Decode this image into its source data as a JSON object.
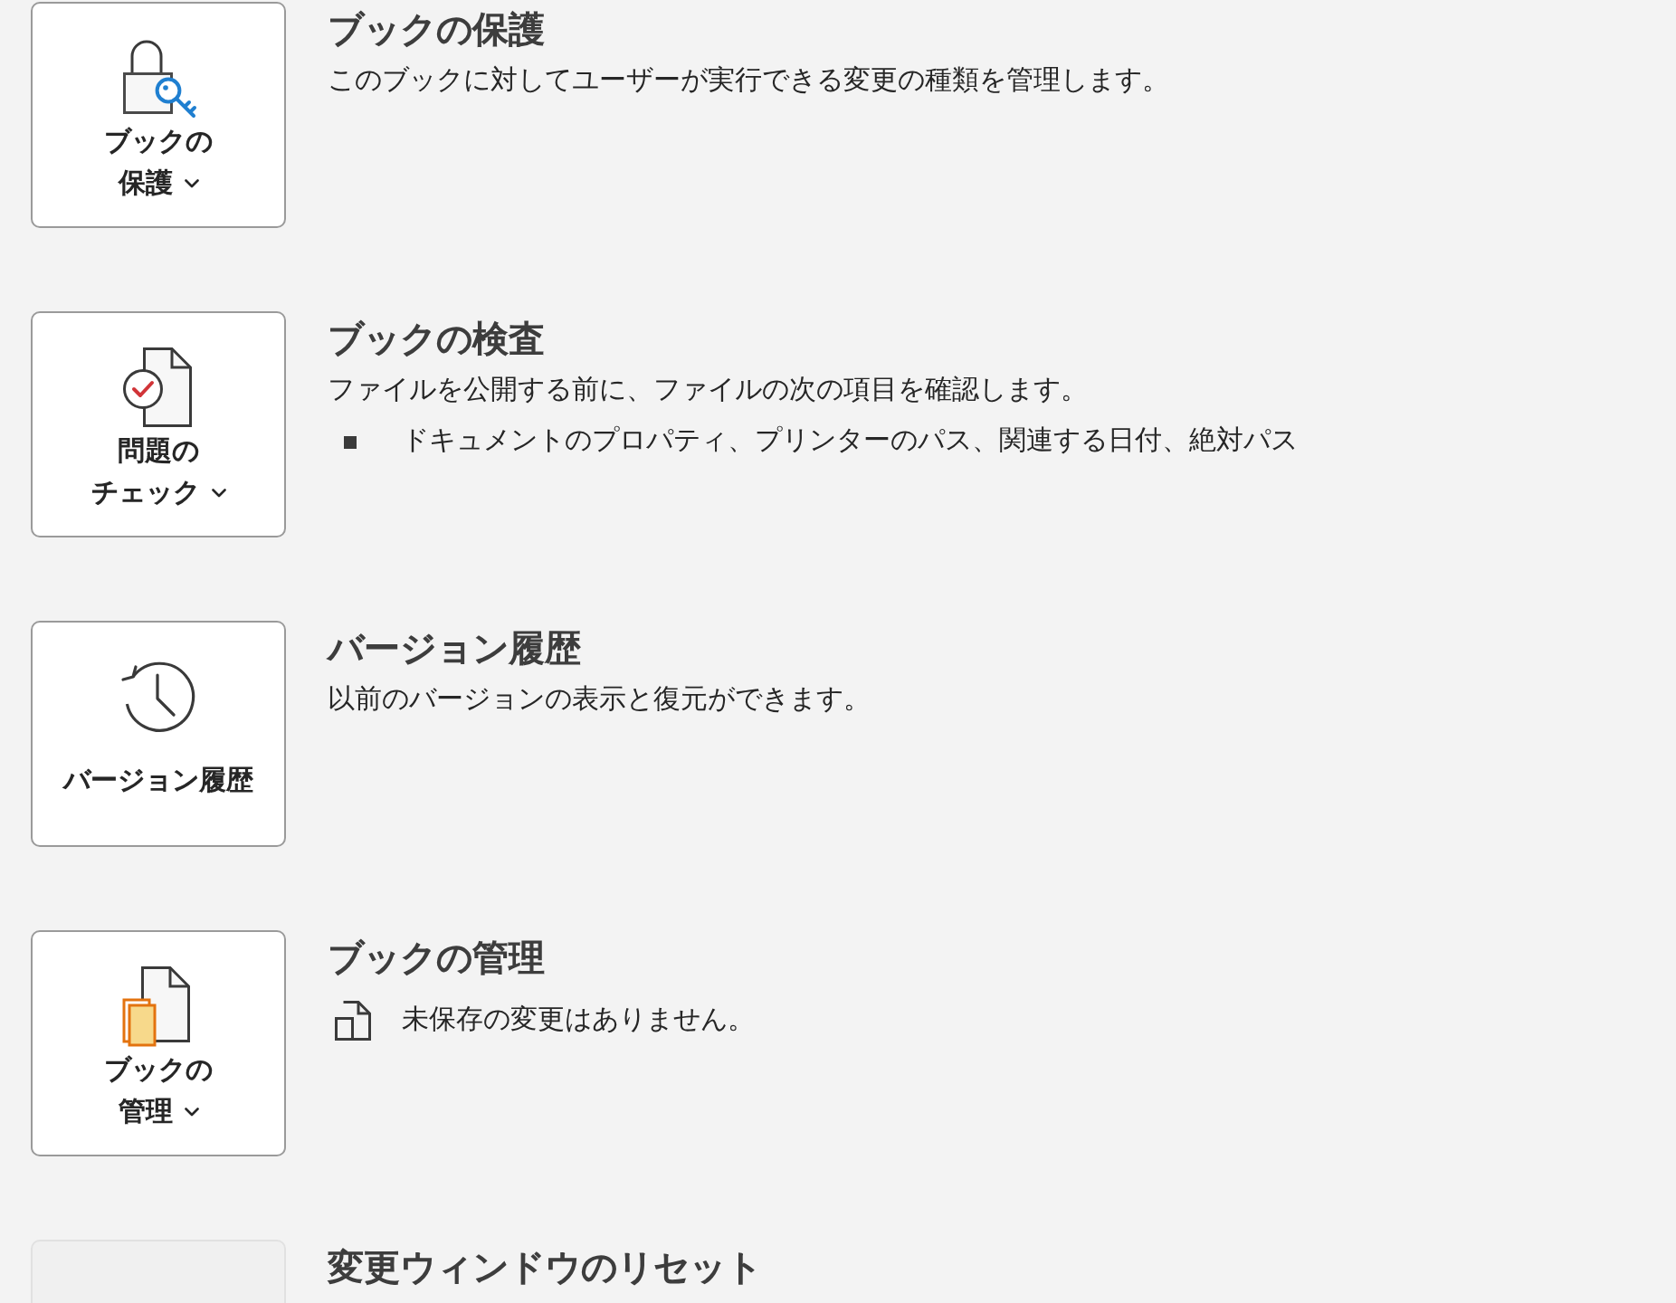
{
  "sections": [
    {
      "button": {
        "kind": "protect",
        "label_lines": [
          "ブックの",
          "保護"
        ],
        "has_menu": true,
        "disabled": false
      },
      "title": "ブックの保護",
      "description": "このブックに対してユーザーが実行できる変更の種類を管理します。"
    },
    {
      "button": {
        "kind": "inspect",
        "label_lines": [
          "問題の",
          "チェック"
        ],
        "has_menu": true,
        "disabled": false
      },
      "title": "ブックの検査",
      "description": "ファイルを公開する前に、ファイルの次の項目を確認します。",
      "bullets": [
        "ドキュメントのプロパティ、プリンターのパス、関連する日付、絶対パス"
      ]
    },
    {
      "button": {
        "kind": "history",
        "label_lines": [
          "バージョン履歴"
        ],
        "has_menu": false,
        "disabled": false
      },
      "title": "バージョン履歴",
      "description": "以前のバージョンの表示と復元ができます。"
    },
    {
      "button": {
        "kind": "manage",
        "label_lines": [
          "ブックの",
          "管理"
        ],
        "has_menu": true,
        "disabled": false
      },
      "title": "ブックの管理",
      "status": {
        "text": "未保存の変更はありません。"
      }
    },
    {
      "button": {
        "kind": "blank",
        "disabled": true
      },
      "title": "変更ウィンドウのリセット"
    }
  ]
}
